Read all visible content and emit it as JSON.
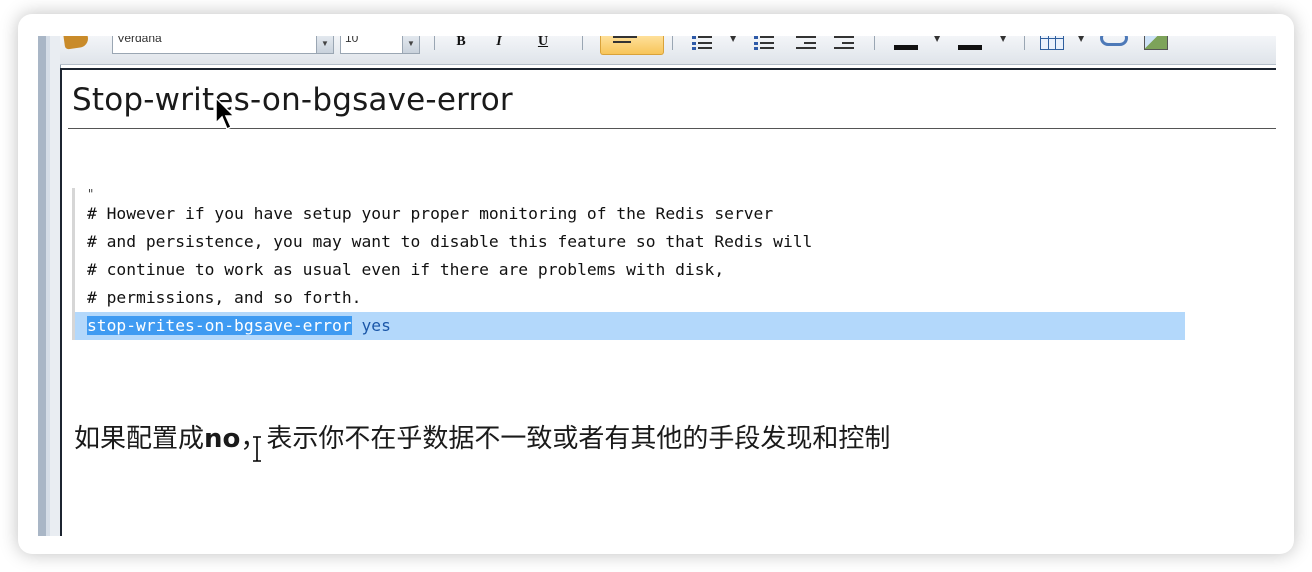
{
  "toolbar": {
    "font_name": "Verdana",
    "font_size": "10",
    "bold_label": "B",
    "italic_label": "I",
    "underline_label": "U",
    "icons": [
      "tag-icon",
      "bold-icon",
      "italic-icon",
      "underline-icon",
      "align-left-icon",
      "numbered-list-icon",
      "bullet-list-icon",
      "outdent-icon",
      "indent-icon",
      "highlight-color-icon",
      "font-color-icon",
      "table-icon",
      "link-icon",
      "image-icon"
    ]
  },
  "document": {
    "heading": "Stop-writes-on-bgsave-error",
    "code_dot": "\"",
    "code_lines": [
      "# However if you have setup your proper monitoring of the Redis server",
      "# and persistence, you may want to disable this feature so that Redis will",
      "# continue to work as usual even if there are problems with disk,",
      "# permissions, and so forth."
    ],
    "config_key": "stop-writes-on-bgsave-error",
    "config_value": " yes",
    "note_before": "如果配置成",
    "note_emphasis": "no",
    "note_after": "，表示你不在乎数据不一致或者有其他的手段发现和控制"
  },
  "colors": {
    "selection": "#b3d8fb",
    "selection_strong": "#3f9bf2",
    "toolbar_active": "#f7c55a"
  }
}
